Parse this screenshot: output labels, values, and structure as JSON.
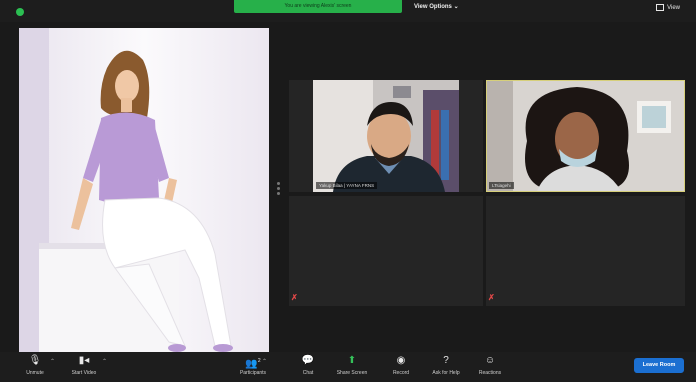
{
  "header": {
    "share_banner": "You are viewing Alexis' screen",
    "view_options": "View Options",
    "view_toggle": "View"
  },
  "participants": [
    {
      "name": "Yakup Bilaa | YAYNA FRNS",
      "muted": true
    },
    {
      "name": "LTsiagehi",
      "muted": true
    }
  ],
  "toolbar": {
    "unmute": "Unmute",
    "start_video": "Start Video",
    "participants": "Participants",
    "participants_count": "2",
    "chat": "Chat",
    "share_screen": "Share Screen",
    "record": "Record",
    "ask_for_help": "Ask for Help",
    "reactions": "Reactions",
    "leave_room": "Leave Room"
  },
  "colors": {
    "accent_green": "#27b04a",
    "active_speaker_border": "#d6cf7a",
    "leave_blue": "#1b6fd1"
  }
}
